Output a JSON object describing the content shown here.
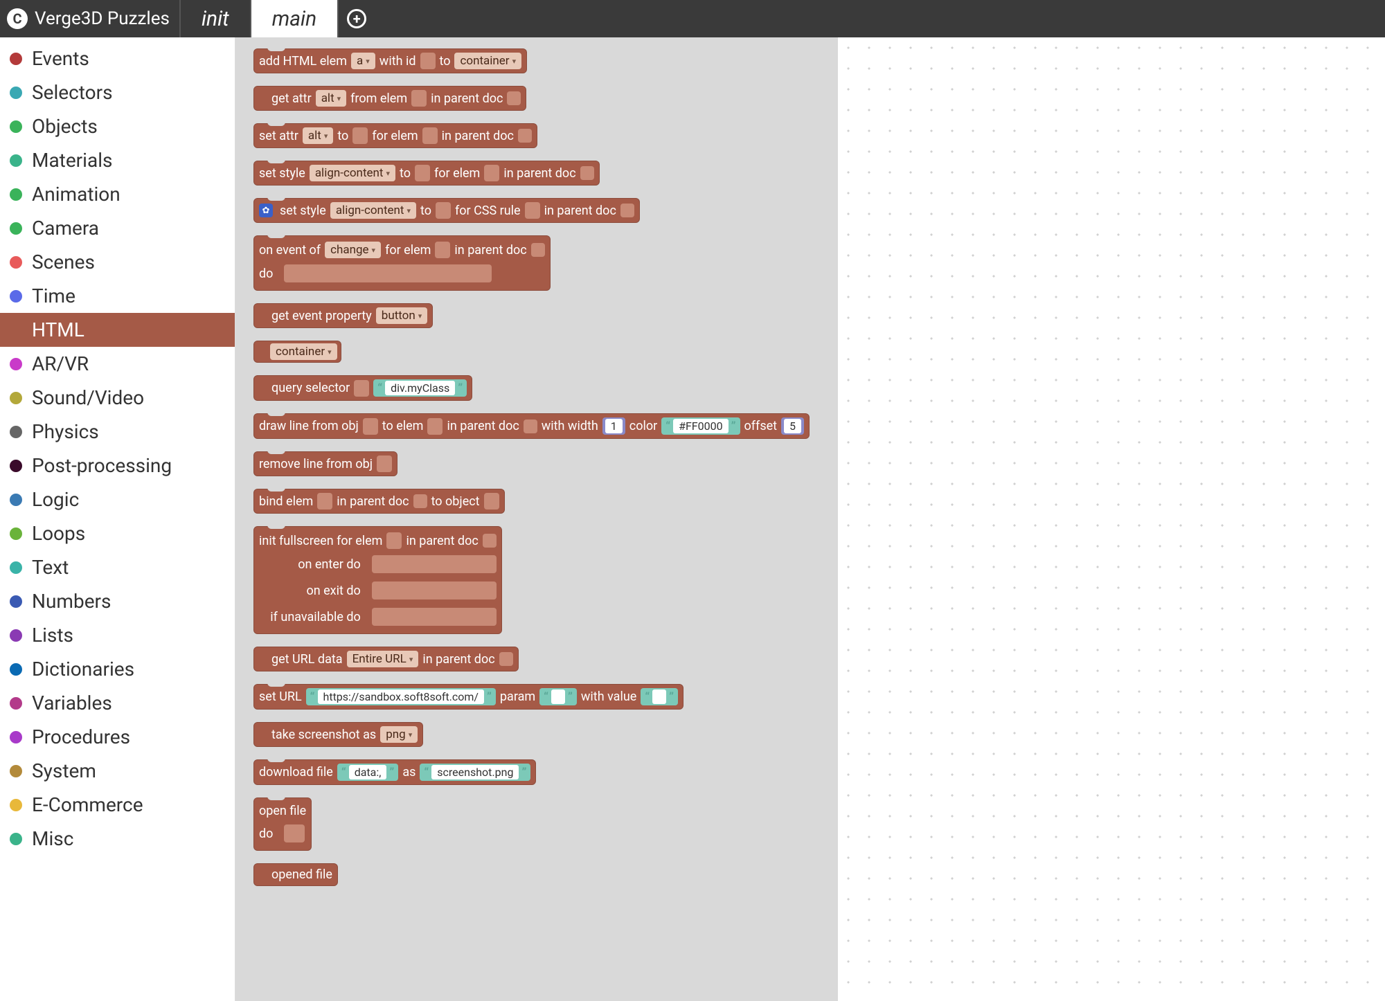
{
  "header": {
    "title": "Verge3D Puzzles",
    "tabs": [
      {
        "label": "init",
        "active": false
      },
      {
        "label": "main",
        "active": true
      }
    ]
  },
  "sidebar": [
    {
      "label": "Events",
      "color": "#b33a3a"
    },
    {
      "label": "Selectors",
      "color": "#3aa8b3"
    },
    {
      "label": "Objects",
      "color": "#3ab35a"
    },
    {
      "label": "Materials",
      "color": "#3ab38a"
    },
    {
      "label": "Animation",
      "color": "#3ab35a"
    },
    {
      "label": "Camera",
      "color": "#3ab35a"
    },
    {
      "label": "Scenes",
      "color": "#e85a5a"
    },
    {
      "label": "Time",
      "color": "#5a6ae8"
    },
    {
      "label": "HTML",
      "color": "#a55a47",
      "selected": true
    },
    {
      "label": "AR/VR",
      "color": "#c93ac9"
    },
    {
      "label": "Sound/Video",
      "color": "#b3a83a"
    },
    {
      "label": "Physics",
      "color": "#666666"
    },
    {
      "label": "Post-processing",
      "color": "#3a0a2a"
    },
    {
      "label": "Logic",
      "color": "#3a7ab3"
    },
    {
      "label": "Loops",
      "color": "#6ab33a"
    },
    {
      "label": "Text",
      "color": "#3ab3a8"
    },
    {
      "label": "Numbers",
      "color": "#3a5ab3"
    },
    {
      "label": "Lists",
      "color": "#8a3ab3"
    },
    {
      "label": "Dictionaries",
      "color": "#0a6ab3"
    },
    {
      "label": "Variables",
      "color": "#b33a8a"
    },
    {
      "label": "Procedures",
      "color": "#a83ac9"
    },
    {
      "label": "System",
      "color": "#b38a3a"
    },
    {
      "label": "E-Commerce",
      "color": "#e8b83a"
    },
    {
      "label": "Misc",
      "color": "#3ab38a"
    }
  ],
  "b": {
    "add_html": {
      "t1": "add HTML elem",
      "d1": "a",
      "t2": "with id",
      "t3": "to",
      "d2": "container"
    },
    "get_attr": {
      "t1": "get attr",
      "d1": "alt",
      "t2": "from elem",
      "t3": "in parent doc"
    },
    "set_attr": {
      "t1": "set attr",
      "d1": "alt",
      "t2": "to",
      "t3": "for elem",
      "t4": "in parent doc"
    },
    "set_style": {
      "t1": "set style",
      "d1": "align-content",
      "t2": "to",
      "t3": "for elem",
      "t4": "in parent doc"
    },
    "set_style_css": {
      "t1": "set style",
      "d1": "align-content",
      "t2": "to",
      "t3": "for CSS rule",
      "t4": "in parent doc"
    },
    "on_event": {
      "t1": "on event of",
      "d1": "change",
      "t2": "for elem",
      "t3": "in parent doc",
      "do": "do"
    },
    "get_event_prop": {
      "t1": "get event property",
      "d1": "button"
    },
    "container": {
      "d1": "container"
    },
    "query": {
      "t1": "query selector",
      "s1": "div.myClass"
    },
    "draw_line": {
      "t1": "draw line from obj",
      "t2": "to elem",
      "t3": "in parent doc",
      "t4": "with width",
      "n1": "1",
      "t5": "color",
      "s1": "#FF0000",
      "t6": "offset",
      "n2": "5"
    },
    "remove_line": {
      "t1": "remove line from obj"
    },
    "bind_elem": {
      "t1": "bind elem",
      "t2": "in parent doc",
      "t3": "to object"
    },
    "fullscreen": {
      "t1": "init fullscreen for elem",
      "t2": "in parent doc",
      "r1": "on enter do",
      "r2": "on exit do",
      "r3": "if unavailable do"
    },
    "get_url": {
      "t1": "get URL data",
      "d1": "Entire URL",
      "t2": "in parent doc"
    },
    "set_url": {
      "t1": "set URL",
      "s1": "https://sandbox.soft8soft.com/",
      "t2": "param",
      "t3": "with value"
    },
    "screenshot": {
      "t1": "take screenshot as",
      "d1": "png"
    },
    "download": {
      "t1": "download file",
      "s1": "data:,",
      "t2": "as",
      "s2": "screenshot.png"
    },
    "open_file": {
      "t1": "open file",
      "do": "do"
    },
    "opened_file": {
      "t1": "opened file"
    }
  }
}
